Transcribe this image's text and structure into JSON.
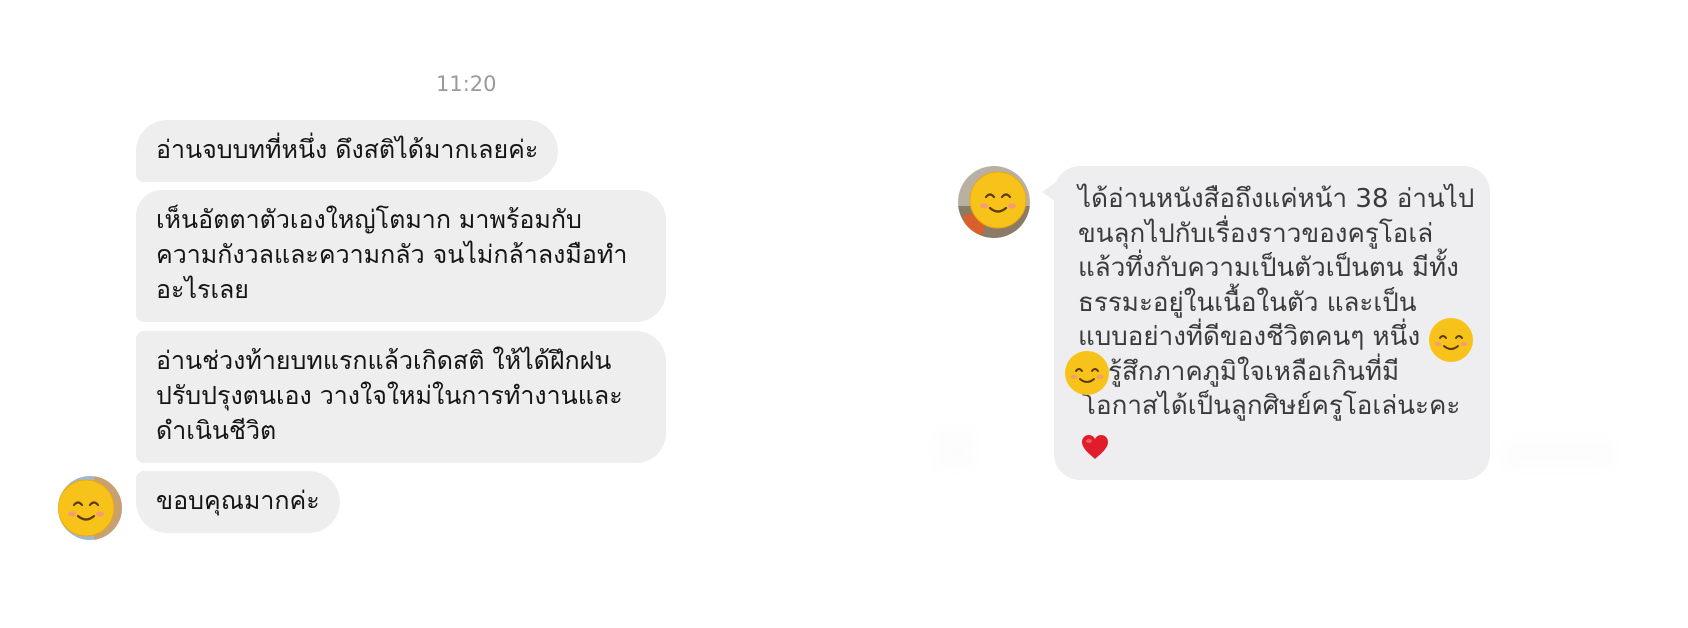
{
  "left_chat": {
    "timestamp": "11:20",
    "messages": [
      {
        "lines": [
          "อ่านจบบทที่หนึ่ง ดึงสติได้มากเลยค่ะ"
        ]
      },
      {
        "lines": [
          "เห็นอัตตาตัวเองใหญ่โตมาก มาพร้อมกับ",
          "ความกังวลและความกลัว จนไม่กล้าลงมือทำ",
          "อะไรเลย"
        ]
      },
      {
        "lines": [
          "อ่านช่วงท้ายบทแรกแล้วเกิดสติ ให้ได้ฝึกฝน",
          "ปรับปรุงตนเอง วางใจใหม่ในการทำงานและ",
          "ดำเนินชีวิต"
        ]
      },
      {
        "lines": [
          "ขอบคุณมากค่ะ"
        ]
      }
    ],
    "avatar_icon": "smiling-face-emoji-avatar"
  },
  "right_chat": {
    "message_lines": [
      "ได้อ่านหนังสือถึงแค่หน้า 38 อ่านไป",
      "ขนลุกไปกับเรื่องราวของครูโอเล่",
      "แล้วทึ่งกับความเป็นตัวเป็นตน มีทั้ง",
      "ธรรมะอยู่ในเนื้อในตัว และเป็น",
      "แบบอย่างที่ดีของชีวิตคนๆ หนึ่ง",
      "รู้สึกภาคภูมิใจเหลือเกินที่มี",
      "โอกาสได้เป็นลูกศิษย์ครูโอเล่นะคะ"
    ],
    "avatar_icon": "smiling-face-emoji-avatar",
    "inline_emojis": [
      "smiling-face-emoji",
      "smiling-face-emoji",
      "red-heart-emoji"
    ]
  },
  "colors": {
    "bubble": "#eeeeee",
    "timestamp": "#9a9a9a",
    "text": "#141414",
    "emoji_yellow": "#f7c21a",
    "heart": "#e01e2b"
  }
}
